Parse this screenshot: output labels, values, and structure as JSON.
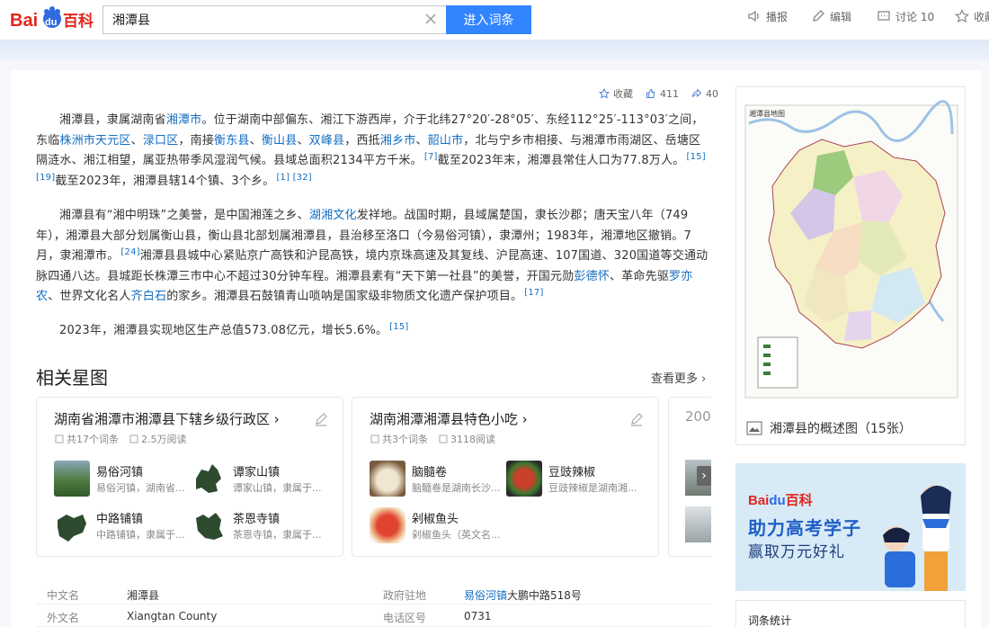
{
  "header": {
    "logo_text_left": "Bai",
    "logo_text_mid": "du",
    "logo_text_right": "百科",
    "search_value": "湘潭县",
    "enter_button": "进入词条",
    "actions": {
      "broadcast": "播报",
      "edit": "编辑",
      "discuss": "讨论 10",
      "favorite": "收藏"
    }
  },
  "tools": {
    "favorite": "收藏",
    "like_count": "411",
    "share_count": "40"
  },
  "paragraphs": {
    "p1": [
      {
        "t": "湘潭县，隶属湖南省"
      },
      {
        "t": "湘潭市",
        "link": true
      },
      {
        "t": "。位于湖南中部偏东、湘江下游西岸，介于北纬27°20′-28°05′、东经112°25′-113°03′之间，东临"
      },
      {
        "t": "株洲市天元区",
        "link": true
      },
      {
        "t": "、"
      },
      {
        "t": "渌口区",
        "link": true
      },
      {
        "t": "，南接"
      },
      {
        "t": "衡东县",
        "link": true
      },
      {
        "t": "、"
      },
      {
        "t": "衡山县",
        "link": true
      },
      {
        "t": "、"
      },
      {
        "t": "双峰县",
        "link": true
      },
      {
        "t": "，西抵"
      },
      {
        "t": "湘乡市",
        "link": true
      },
      {
        "t": "、"
      },
      {
        "t": "韶山市",
        "link": true
      },
      {
        "t": "，北与宁乡市相接、与湘潭市雨湖区、岳塘区隔涟水、湘江相望，属亚热带季风湿润气候。县域总面积2134平方千米。"
      },
      {
        "t": "[7]",
        "sup": true
      },
      {
        "t": "截至2023年末，湘潭县常住人口为77.8万人。"
      },
      {
        "t": "[15] [19]",
        "sup": true
      },
      {
        "t": "截至2023年，湘潭县辖14个镇、3个乡。"
      },
      {
        "t": "[1] [32]",
        "sup": true
      }
    ],
    "p2": [
      {
        "t": "湘潭县有“湘中明珠”之美誉，是中国湘莲之乡、"
      },
      {
        "t": "湖湘文化",
        "link": true
      },
      {
        "t": "发祥地。战国时期，县域属楚国，隶长沙郡；唐天宝八年（749年），湘潭县大部分划属衡山县，衡山县北部划属湘潭县，县治移至洛口（今易俗河镇），隶潭州；1983年，湘潭地区撤销。7月，隶湘潭市。"
      },
      {
        "t": "[24]",
        "sup": true
      },
      {
        "t": "湘潭县县城中心紧贴京广高铁和沪昆高铁，境内京珠高速及其复线、沪昆高速、107国道、320国道等交通动脉四通八达。县城距长株潭三市中心不超过30分钟车程。湘潭县素有“天下第一社县”的美誉，开国元勋"
      },
      {
        "t": "彭德怀",
        "link": true
      },
      {
        "t": "、革命先驱"
      },
      {
        "t": "罗亦农",
        "link": true
      },
      {
        "t": "、世界文化名人"
      },
      {
        "t": "齐白石",
        "link": true
      },
      {
        "t": "的家乡。湘潭县石鼓镇青山唢呐是国家级非物质文化遗产保护项目。"
      },
      {
        "t": "[17]",
        "sup": true
      }
    ],
    "p3": [
      {
        "t": "2023年，湘潭县实现地区生产总值573.08亿元，增长5.6%。"
      },
      {
        "t": "[15]",
        "sup": true
      }
    ]
  },
  "related": {
    "title": "相关星图",
    "more": "查看更多",
    "cards": [
      {
        "title": "湖南省湘潭市湘潭县下辖乡级行政区",
        "count": "共17个词条",
        "reads": "2.5万阅读",
        "items": [
          {
            "name": "易俗河镇",
            "desc": "易俗河镇，湖南省..."
          },
          {
            "name": "谭家山镇",
            "desc": "谭家山镇，隶属于..."
          },
          {
            "name": "中路铺镇",
            "desc": "中路铺镇，隶属于..."
          },
          {
            "name": "茶恩寺镇",
            "desc": "茶恩寺镇，隶属于..."
          }
        ]
      },
      {
        "title": "湖南湘潭湘潭县特色小吃",
        "count": "共3个词条",
        "reads": "3118阅读",
        "items": [
          {
            "name": "脑髓卷",
            "desc": "脑髓卷是湖南长沙..."
          },
          {
            "name": "豆豉辣椒",
            "desc": "豆豉辣椒是湖南湘..."
          },
          {
            "name": "剁椒鱼头",
            "desc": "剁椒鱼头（英文名..."
          }
        ]
      }
    ],
    "card3_peek": "200"
  },
  "infobox": {
    "rows": [
      {
        "k1": "中文名",
        "v1": "湘潭县",
        "k2": "政府驻地",
        "v2_link": "易俗河镇",
        "v2": "大鹏中路518号"
      },
      {
        "k1": "外文名",
        "v1": "Xiangtan County",
        "k2": "电话区号",
        "v2_link": "",
        "v2": "0731"
      }
    ]
  },
  "sidebar": {
    "map_title": "湘潭县地图",
    "map_caption": "湘潭县的概述图（15张）",
    "ad_logo": "百科",
    "ad_line1": "助力高考学子",
    "ad_line2": "赢取万元好礼",
    "stats_title": "词条统计"
  },
  "colors": {
    "link": "#136ec2",
    "brand_blue": "#3385ff",
    "brand_red": "#e1261c"
  }
}
